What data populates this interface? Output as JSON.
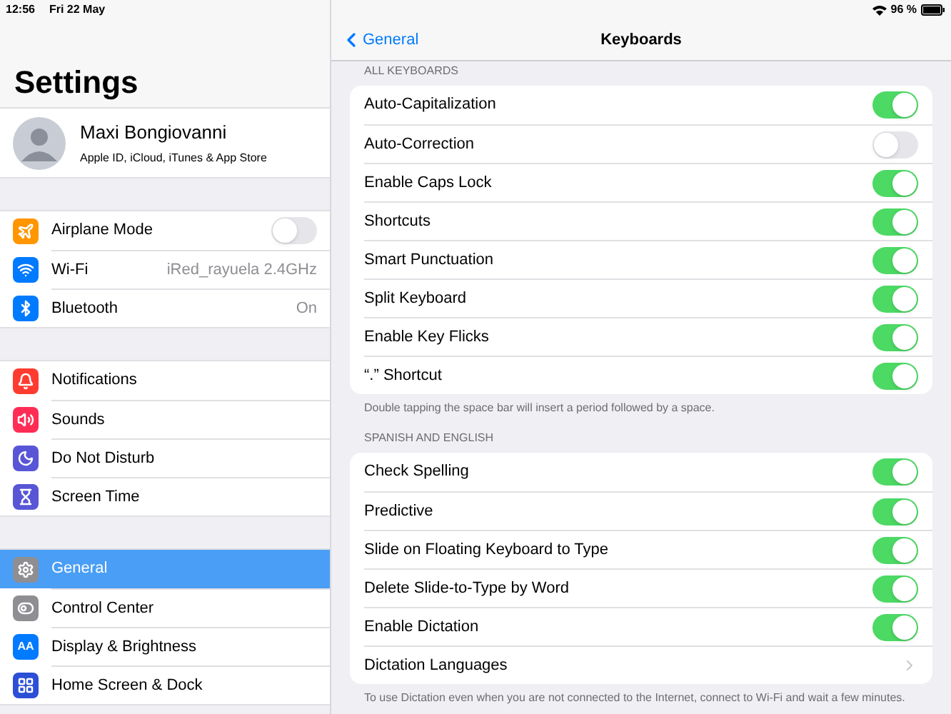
{
  "status_bar": {
    "time": "12:56",
    "date": "Fri 22 May",
    "battery": "96 %"
  },
  "sidebar": {
    "title": "Settings",
    "profile": {
      "name": "Maxi Bongiovanni",
      "subtitle": "Apple ID, iCloud, iTunes & App Store"
    },
    "groups": [
      [
        {
          "label": "Airplane Mode",
          "kind": "toggle",
          "on": false,
          "selected": false
        },
        {
          "label": "Wi-Fi",
          "kind": "value",
          "value": "iRed_rayuela 2.4GHz",
          "selected": false
        },
        {
          "label": "Bluetooth",
          "kind": "value",
          "value": "On",
          "selected": false
        }
      ],
      [
        {
          "label": "Notifications",
          "kind": "link",
          "selected": false
        },
        {
          "label": "Sounds",
          "kind": "link",
          "selected": false
        },
        {
          "label": "Do Not Disturb",
          "kind": "link",
          "selected": false
        },
        {
          "label": "Screen Time",
          "kind": "link",
          "selected": false
        }
      ],
      [
        {
          "label": "General",
          "kind": "link",
          "selected": true
        },
        {
          "label": "Control Center",
          "kind": "link",
          "selected": false
        },
        {
          "label": "Display & Brightness",
          "kind": "link",
          "icon_text": "AA",
          "selected": false
        },
        {
          "label": "Home Screen & Dock",
          "kind": "link",
          "selected": false
        }
      ]
    ]
  },
  "detail": {
    "back": "General",
    "title": "Keyboards",
    "sections": [
      {
        "header": "ALL KEYBOARDS",
        "rows": [
          {
            "label": "Auto-Capitalization",
            "kind": "toggle",
            "on": true
          },
          {
            "label": "Auto-Correction",
            "kind": "toggle",
            "on": false
          },
          {
            "label": "Enable Caps Lock",
            "kind": "toggle",
            "on": true
          },
          {
            "label": "Shortcuts",
            "kind": "toggle",
            "on": true
          },
          {
            "label": "Smart Punctuation",
            "kind": "toggle",
            "on": true
          },
          {
            "label": "Split Keyboard",
            "kind": "toggle",
            "on": true
          },
          {
            "label": "Enable Key Flicks",
            "kind": "toggle",
            "on": true
          },
          {
            "label": "“.” Shortcut",
            "kind": "toggle",
            "on": true
          }
        ],
        "footer": "Double tapping the space bar will insert a period followed by a space."
      },
      {
        "header": "SPANISH AND ENGLISH",
        "rows": [
          {
            "label": "Check Spelling",
            "kind": "toggle",
            "on": true
          },
          {
            "label": "Predictive",
            "kind": "toggle",
            "on": true
          },
          {
            "label": "Slide on Floating Keyboard to Type",
            "kind": "toggle",
            "on": true
          },
          {
            "label": "Delete Slide-to-Type by Word",
            "kind": "toggle",
            "on": true
          },
          {
            "label": "Enable Dictation",
            "kind": "toggle",
            "on": true
          },
          {
            "label": "Dictation Languages",
            "kind": "link"
          }
        ],
        "footer": "To use Dictation even when you are not connected to the Internet, connect to Wi-Fi and wait a few minutes."
      }
    ]
  }
}
